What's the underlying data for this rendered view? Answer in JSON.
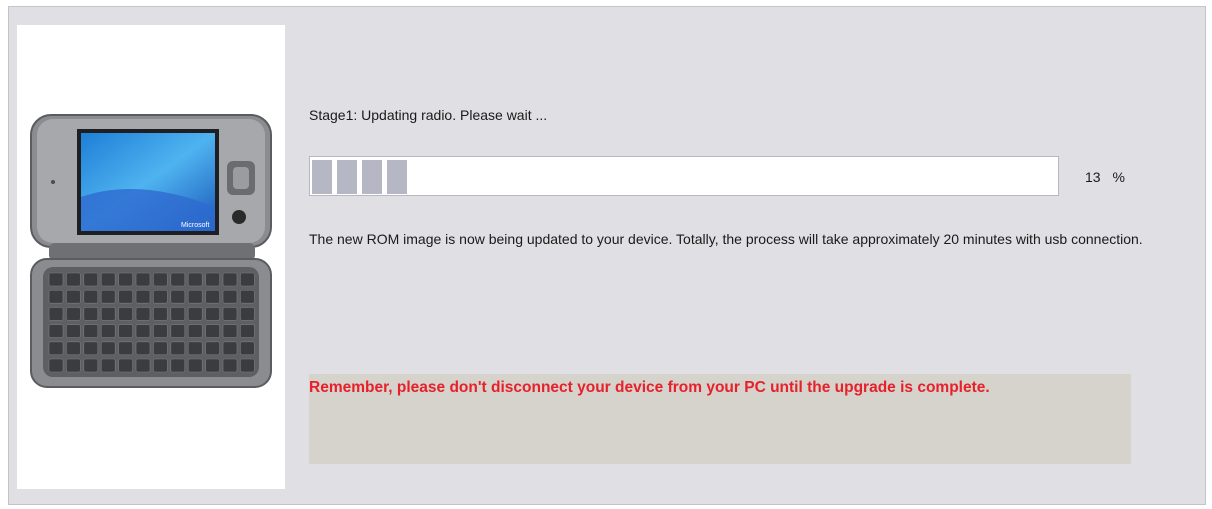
{
  "stage_text": "Stage1: Updating radio. Please wait ...",
  "progress": {
    "percent_value": "13",
    "percent_sign": "%",
    "fraction": 0.13
  },
  "description": "The new ROM image is now being updated to your device. Totally, the process will take approximately 20 minutes with usb connection.",
  "warning": "Remember, please don't disconnect your device from your PC until the upgrade is complete.",
  "device_brand": "Microsoft",
  "colors": {
    "warning_text": "#e8202a",
    "warning_bg": "#d6d2cc",
    "progress_block": "#b5b8c4",
    "panel_bg": "#e0e0e4"
  }
}
